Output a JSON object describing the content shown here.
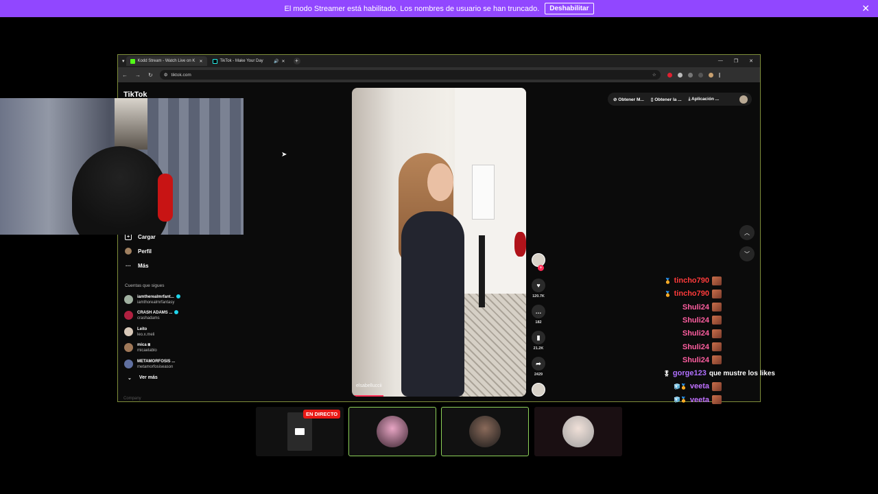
{
  "colors": {
    "banner": "#9147ff",
    "frame": "#7f8f3a",
    "frame2": "#8fd45a",
    "tiktok_red": "#fe2c55"
  },
  "banner": {
    "message": "El modo Streamer está habilitado. Los nombres de usuario se han truncado.",
    "button": "Deshabilitar",
    "close_icon": "✕"
  },
  "browser": {
    "tabs": [
      {
        "title": "Kodd Stream - Watch Live on K",
        "active": true,
        "favicon": "kick"
      },
      {
        "title": "TikTok - Make Your Day",
        "active": false,
        "favicon": "tiktok"
      }
    ],
    "url": "tiktok.com"
  },
  "tiktok": {
    "logo": "TikTok",
    "sidebar": [
      {
        "label": "Cargar",
        "icon": "upload-icon",
        "glyph": "+"
      },
      {
        "label": "Perfil",
        "icon": "profile-avatar",
        "glyph": ""
      },
      {
        "label": "Más",
        "icon": "more-icon",
        "glyph": "···"
      }
    ],
    "following_title": "Cuentas que sigues",
    "accounts": [
      {
        "name": "iamtherealmrfant...",
        "handle": "iamthorealmrfantasy",
        "verified": true,
        "color": "#a0b0a0"
      },
      {
        "name": "CRASH ADAMS ...",
        "handle": "crashadams",
        "verified": true,
        "color": "#b02040"
      },
      {
        "name": "Leito",
        "handle": "leo.x.meli",
        "verified": false,
        "color": "#d8c8b8"
      },
      {
        "name": "mica ⧈",
        "handle": "micaelablo",
        "verified": false,
        "color": "#a07858"
      },
      {
        "name": "METAMORFOSIS ...",
        "handle": "metamorfosiseason",
        "verified": false,
        "color": "#6070a0"
      }
    ],
    "see_more": "Ver más",
    "company": "Company",
    "topbar": [
      "Obtener M...",
      "Obtener la ...",
      "Aplicación ..."
    ],
    "video": {
      "caption": "elsabelluccii",
      "progress": 0.18
    },
    "actions": [
      {
        "name": "like",
        "glyph": "♥",
        "count": "120.7K"
      },
      {
        "name": "comment",
        "glyph": "…",
        "count": "182"
      },
      {
        "name": "bookmark",
        "glyph": "▮",
        "count": "21.2K"
      },
      {
        "name": "share",
        "glyph": "➦",
        "count": "2429"
      }
    ]
  },
  "chat": [
    {
      "user": "tincho790",
      "color": "#ff3b3b",
      "badge": "🏅",
      "text": "",
      "emote": true
    },
    {
      "user": "tincho790",
      "color": "#ff3b3b",
      "badge": "🏅",
      "text": "",
      "emote": true
    },
    {
      "user": "Shuli24",
      "color": "#ff5ea0",
      "badge": "",
      "text": "",
      "emote": true
    },
    {
      "user": "Shuli24",
      "color": "#ff5ea0",
      "badge": "",
      "text": "",
      "emote": true
    },
    {
      "user": "Shuli24",
      "color": "#ff5ea0",
      "badge": "",
      "text": "",
      "emote": true
    },
    {
      "user": "Shuli24",
      "color": "#ff5ea0",
      "badge": "",
      "text": "",
      "emote": true
    },
    {
      "user": "Shuli24",
      "color": "#ff5ea0",
      "badge": "",
      "text": "",
      "emote": true
    },
    {
      "user": "gorge123",
      "color": "#b070ff",
      "badge": "🎖",
      "text": "que mustre los likes",
      "emote": false
    },
    {
      "user": "veeta",
      "color": "#c070ff",
      "badge": "🧊🏅",
      "text": "",
      "emote": true
    },
    {
      "user": "veeta",
      "color": "#c070ff",
      "badge": "🧊🏅",
      "text": "",
      "emote": true
    }
  ],
  "bottom": {
    "live_label": "EN DIRECTO",
    "thumbs": [
      {
        "kind": "screen",
        "selected": false
      },
      {
        "kind": "cam",
        "selected": true,
        "tint": "#d97fb0"
      },
      {
        "kind": "cam",
        "selected": true,
        "tint": "#3a3a3a"
      },
      {
        "kind": "cam",
        "selected": false,
        "tint": "#ddd"
      }
    ]
  }
}
